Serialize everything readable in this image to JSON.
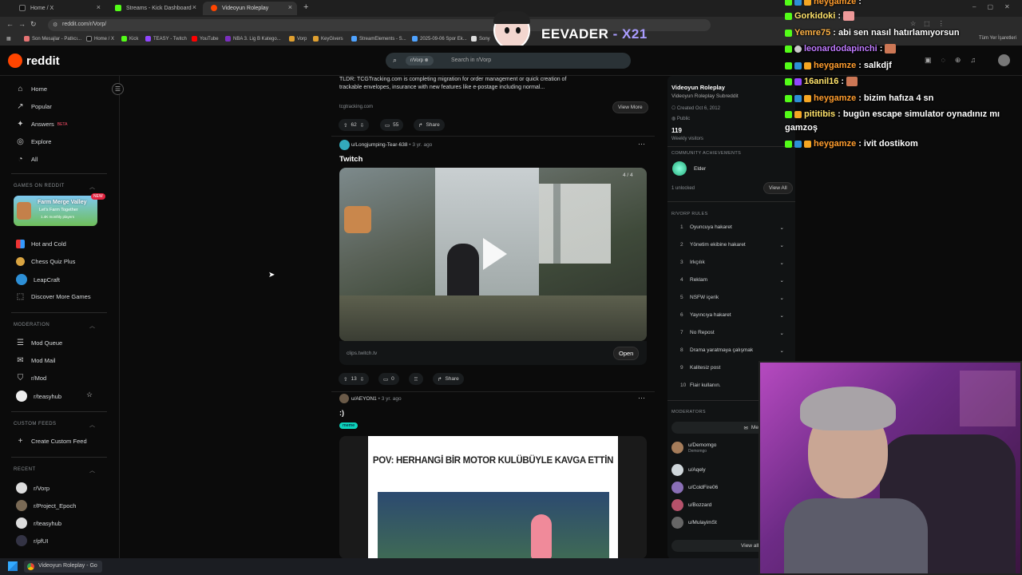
{
  "browser": {
    "tabs": [
      {
        "label": "Home / X",
        "color": "#111111"
      },
      {
        "label": "Streams - Kick Dashboard",
        "color": "#53fc18"
      },
      {
        "label": "Videoyun Roleplay",
        "color": "#ff4500"
      }
    ],
    "url": "reddit.com/r/Vorp/",
    "bookmarks": [
      "Son Mesajlar - Patlıcı...",
      "Home / X",
      "Kick",
      "TEASY - Twitch",
      "YouTube",
      "NBA 3. Lig B Katego...",
      "Vorp",
      "KeyGivers",
      "StreamElements - S...",
      "2025-09-06 Spor Ek...",
      "Sony"
    ],
    "bookmarks_right": "Tüm Yer İşaretleri"
  },
  "overlay": {
    "title_a": "EEVADER",
    "title_b": " - X21"
  },
  "reddit": {
    "logo": "reddit",
    "search_chip": "r/Vorp",
    "search_placeholder": "Search in r/Vorp"
  },
  "sidebar": {
    "top": [
      {
        "label": "Home",
        "icon": "home-icon",
        "glyph": "⌂"
      },
      {
        "label": "Popular",
        "icon": "popular-icon",
        "glyph": "↗"
      },
      {
        "label": "Answers",
        "icon": "answers-icon",
        "glyph": "✦",
        "badge": "BETA"
      },
      {
        "label": "Explore",
        "icon": "explore-icon",
        "glyph": "◎"
      },
      {
        "label": "All",
        "icon": "all-icon",
        "glyph": "◔"
      }
    ],
    "games_title": "GAMES ON REDDIT",
    "game_banner": {
      "title": "Farm Merge Valley",
      "sub": "Let's Farm Together",
      "sub2": "1.4K monthly players",
      "badge": "NEW"
    },
    "games": [
      "Hot and Cold",
      "Chess Quiz Plus",
      "LeapCraft",
      "Discover More Games"
    ],
    "moderation_title": "MODERATION",
    "moderation": [
      "Mod Queue",
      "Mod Mail",
      "r/Mod",
      "r/teasyhub"
    ],
    "custom_title": "CUSTOM FEEDS",
    "custom": [
      "Create Custom Feed"
    ],
    "recent_title": "RECENT",
    "recent": [
      "r/Vorp",
      "r/Project_Epoch",
      "r/teasyhub",
      "r/pfUI"
    ]
  },
  "feed": {
    "post0": {
      "text": "TLDR: TCGTracking.com is completing migration for order management or quick creation of trackable envelopes, insurance with new features like e-postage including normal...",
      "domain": "tcgtracking.com",
      "view_more": "View More",
      "votes": "62",
      "comments": "55",
      "share": "Share"
    },
    "post1": {
      "author": "u/Longjumping-Tear-638",
      "age": "• 3 yr. ago",
      "title": "Twitch",
      "video_counter": "4 / 4",
      "link": "clips.twitch.tv",
      "open": "Open",
      "votes": "13",
      "comments": "0",
      "share": "Share"
    },
    "post2": {
      "author": "u/AEYON1",
      "age": "• 3 yr. ago",
      "title": ":)",
      "flair": "meme",
      "meme_caption": "POV: HERHANGİ BİR MOTOR KULÜBÜYLE KAVGA ETTİN"
    }
  },
  "rail": {
    "name": "Videoyun Roleplay",
    "desc": "Videoyun Roleplay Subreddit",
    "created": "Created Oct 6, 2012",
    "visibility": "Public",
    "visitors": "119",
    "visitors_label": "Weekly visitors",
    "achievements_title": "COMMUNITY ACHIEVEMENTS",
    "achievement": "Elder",
    "unlocked": "1 unlocked",
    "view_all": "View All",
    "rules_title": "R/VORP RULES",
    "rules": [
      "Oyuncuya hakaret",
      "Yönetim ekibine hakaret",
      "Irkçılık",
      "Reklam",
      "NSFW içerik",
      "Yayıncıya hakaret",
      "No Repost",
      "Drama yaratmaya çalışmak",
      "Kalitesiz post",
      "Flair kullanın."
    ],
    "moderators_title": "MODERATORS",
    "message_mods": "Message Mods",
    "mods": [
      {
        "name": "u/Demomgo",
        "sub": "Demomgo"
      },
      {
        "name": "u/Aqely",
        "sub": ""
      },
      {
        "name": "u/ColdFire06",
        "sub": ""
      },
      {
        "name": "u/Bozzard",
        "sub": ""
      },
      {
        "name": "u/MulayimSt",
        "sub": ""
      }
    ],
    "view_all_mods": "View all moderators"
  },
  "chat": [
    {
      "user": "heygamze",
      "text": " :",
      "color": "#ff9d2e"
    },
    {
      "user": "Gorkidoki",
      "text": " :",
      "color": "#ffe36b"
    },
    {
      "user": "Yemre75",
      "text": " : abi sen nasıl hatırlamıyorsun",
      "color": "#ffb347"
    },
    {
      "user": "leonardodapinchi",
      "text": " :",
      "color": "#c07bff"
    },
    {
      "user": "heygamze",
      "text": " : salkdjf",
      "color": "#ff9d2e"
    },
    {
      "user": "16anil16",
      "text": " :",
      "color": "#ffe36b"
    },
    {
      "user": "heygamze",
      "text": " : bizim hafıza 4 sn",
      "color": "#ff9d2e"
    },
    {
      "user": "pititibis",
      "text": " : bugün escape simulator oynadınız mı",
      "color": "#ffe36b"
    },
    {
      "user": "",
      "text": "gamzoş",
      "color": "#ffffff"
    },
    {
      "user": "heygamze",
      "text": " : ivit dostikom",
      "color": "#ff9d2e"
    }
  ],
  "taskbar": {
    "app": "Videoyun Roleplay - Go"
  }
}
